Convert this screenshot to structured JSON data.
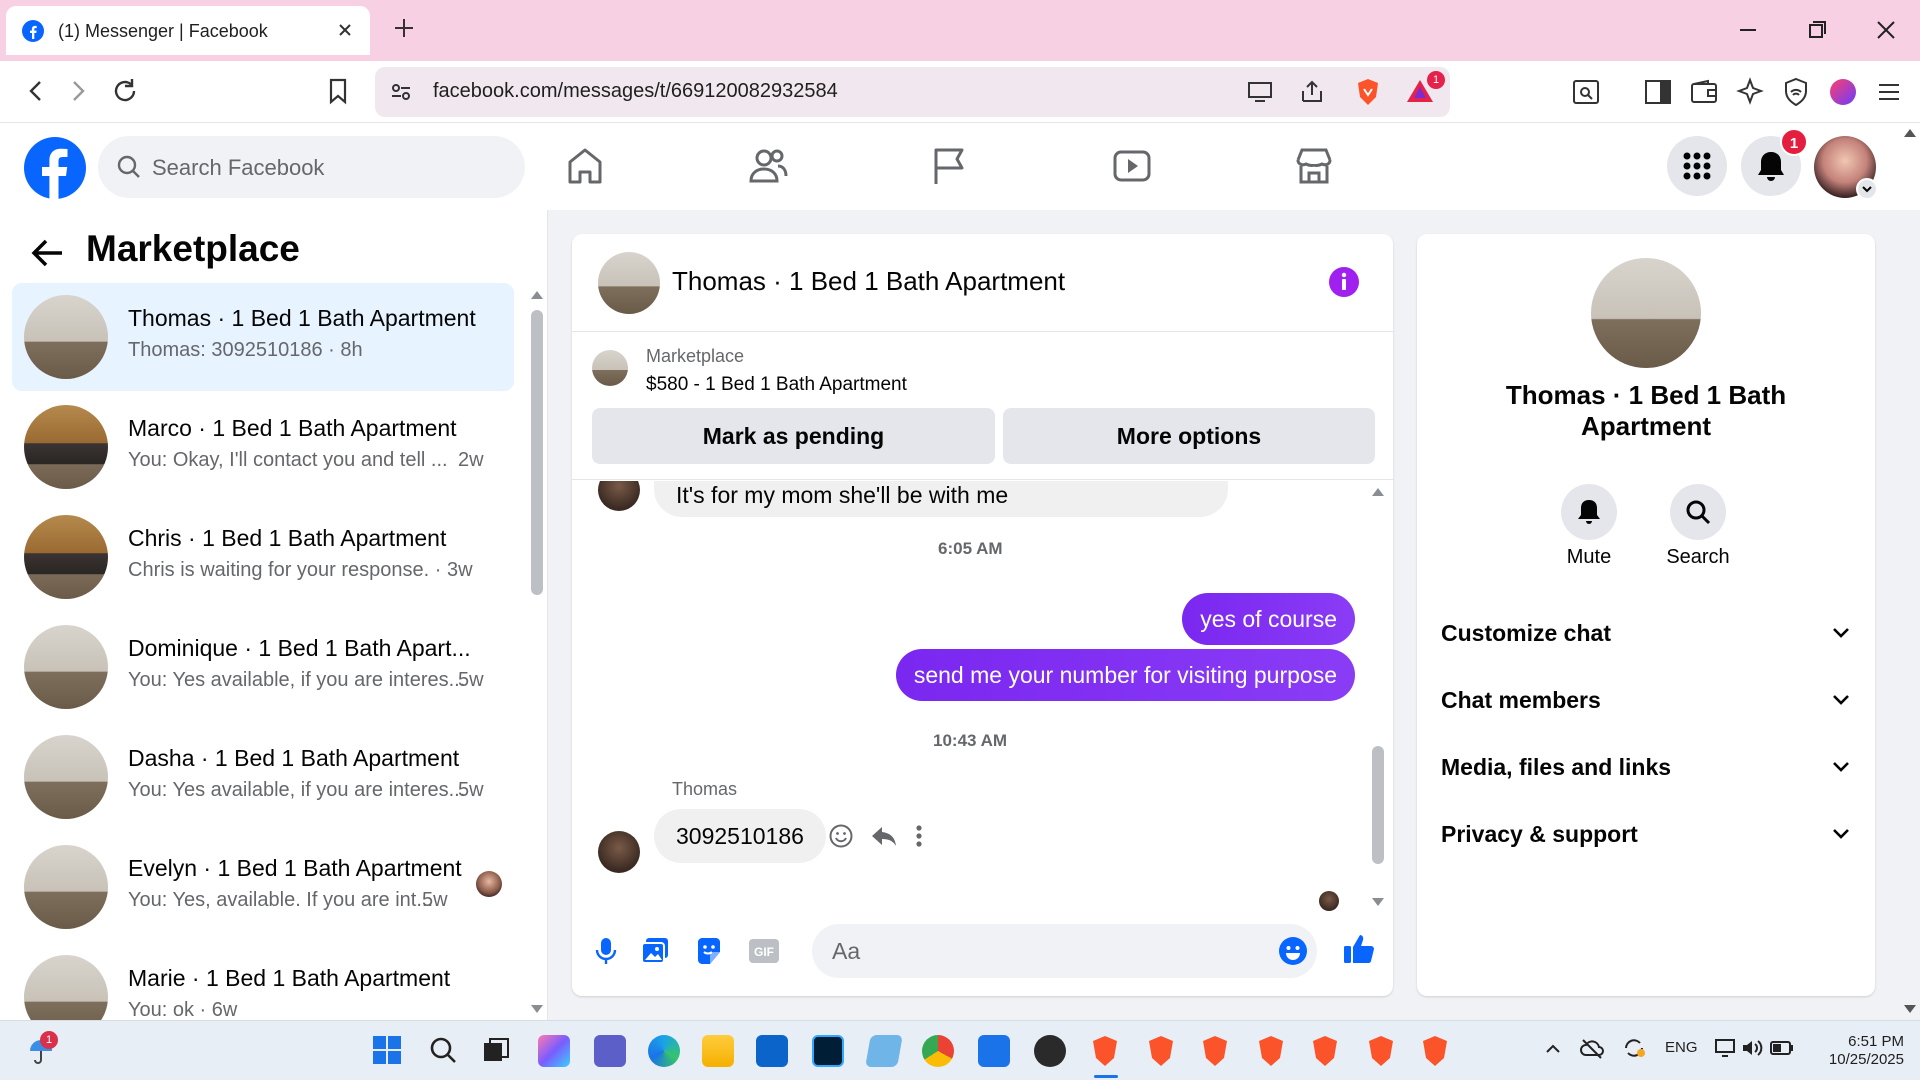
{
  "browser": {
    "tab_title": "(1) Messenger | Facebook",
    "url": "facebook.com/messages/t/669120082932584",
    "brave_rewards_badge": "1"
  },
  "fb": {
    "search_placeholder": "Search Facebook",
    "notifications_badge": "1",
    "nav_icons": [
      "home-icon",
      "friends-icon",
      "pages-icon",
      "watch-icon",
      "marketplace-icon"
    ]
  },
  "sidebar": {
    "heading": "Marketplace",
    "conversations": [
      {
        "name": "Thomas · 1 Bed 1 Bath Apartment",
        "preview": "Thomas: 3092510186 · 8h",
        "time": "",
        "active": true
      },
      {
        "name": "Marco · 1 Bed 1 Bath Apartment",
        "preview": "You: Okay, I'll contact you and tell ...",
        "time": "2w"
      },
      {
        "name": "Chris · 1 Bed 1 Bath Apartment",
        "preview": "Chris is waiting for your response. · 3w",
        "time": ""
      },
      {
        "name": "Dominique · 1 Bed 1 Bath Apart...",
        "preview": "You: Yes available, if you are interes...",
        "time": "5w"
      },
      {
        "name": "Dasha · 1 Bed 1 Bath Apartment",
        "preview": "You: Yes available, if you are interes...",
        "time": "5w"
      },
      {
        "name": "Evelyn · 1 Bed 1 Bath Apartment",
        "preview": "You: Yes, available. If you are int...",
        "time": "5w"
      },
      {
        "name": "Marie · 1 Bed 1 Bath Apartment",
        "preview": "You: ok · 6w",
        "time": ""
      }
    ]
  },
  "chat": {
    "title": "Thomas · 1 Bed 1 Bath Apartment",
    "listing_label": "Marketplace",
    "listing_price": "$580 - 1 Bed 1 Bath Apartment",
    "mark_pending": "Mark as pending",
    "more_options": "More options",
    "messages": {
      "partial_in": "It's for my mom she'll be with me",
      "stamp1": "6:05 AM",
      "out1": "yes of course",
      "out2": "send me your number for visiting purpose",
      "stamp2": "10:43 AM",
      "sender": "Thomas",
      "in1": "3092510186"
    },
    "composer_placeholder": "Aa"
  },
  "info": {
    "name": "Thomas · 1 Bed 1 Bath Apartment",
    "mute": "Mute",
    "search": "Search",
    "sections": [
      "Customize chat",
      "Chat members",
      "Media, files and links",
      "Privacy & support"
    ]
  },
  "taskbar": {
    "lang": "ENG",
    "time": "6:51 PM",
    "date": "10/25/2025"
  },
  "colors": {
    "fb_blue": "#0866ff",
    "messenger_purple": "#8a3cf5",
    "info_purple": "#a020f0",
    "tab_bg": "#f8d0e4"
  }
}
